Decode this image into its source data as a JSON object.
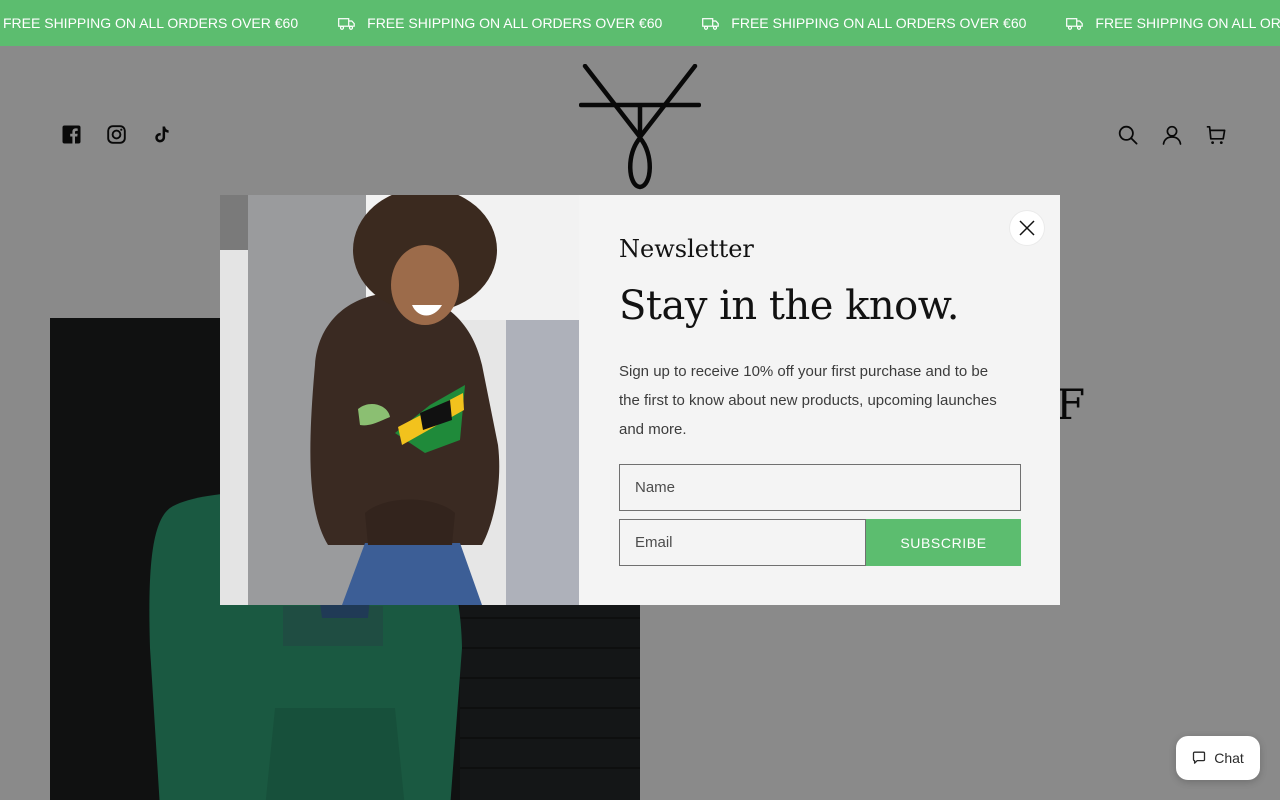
{
  "announcement": {
    "text": "FREE SHIPPING ON ALL ORDERS OVER €60",
    "icon": "truck-icon",
    "background": "#5cbd6f"
  },
  "header": {
    "social": [
      {
        "name": "facebook-icon"
      },
      {
        "name": "instagram-icon"
      },
      {
        "name": "tiktok-icon"
      }
    ],
    "logo": "brand-logo",
    "tools": [
      {
        "name": "search-icon"
      },
      {
        "name": "account-icon"
      },
      {
        "name": "cart-icon"
      }
    ]
  },
  "page": {
    "title_fragment": "F"
  },
  "newsletter": {
    "eyebrow": "Newsletter",
    "headline": "Stay in the know.",
    "blurb": "Sign up to receive 10% off your first purchase and to be the first to know about new products, upcoming launches and more.",
    "name_placeholder": "Name",
    "email_placeholder": "Email",
    "subscribe_label": "SUBSCRIBE",
    "accent": "#5cbd6f"
  },
  "chat": {
    "label": "Chat"
  }
}
